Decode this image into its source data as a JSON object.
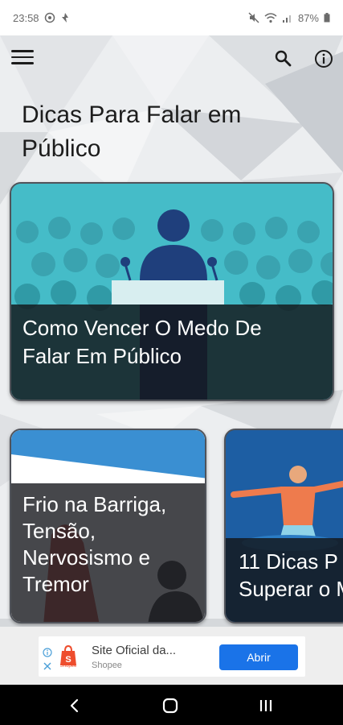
{
  "status_bar": {
    "time": "23:58",
    "battery": "87%"
  },
  "app_bar": {
    "menu_icon": "hamburger-menu-icon",
    "search_icon": "search-icon",
    "info_icon": "info-icon"
  },
  "page_title": "Dicas Para Falar em Público",
  "cards": [
    {
      "title_line1": "Como Vencer O Medo De",
      "title_line2": "Falar Em Público"
    },
    {
      "title_lines": [
        "Frio na Barriga,",
        "Tensão,",
        "Nervosismo e",
        "Tremor"
      ]
    },
    {
      "title_line1": "11 Dicas P",
      "title_line2": "Superar o M"
    }
  ],
  "ad": {
    "title": "Site Oficial da...",
    "advertiser": "Shopee",
    "logo_text": "Shopee",
    "cta": "Abrir"
  },
  "nav_bar": {
    "back_icon": "back-icon",
    "home_icon": "home-icon",
    "recents_icon": "recents-icon"
  },
  "colors": {
    "ad_button": "#1a73e8",
    "card1_bg": "#43b8c4",
    "card3_bg": "#1d5ea3",
    "shopee": "#ee4d2d"
  }
}
